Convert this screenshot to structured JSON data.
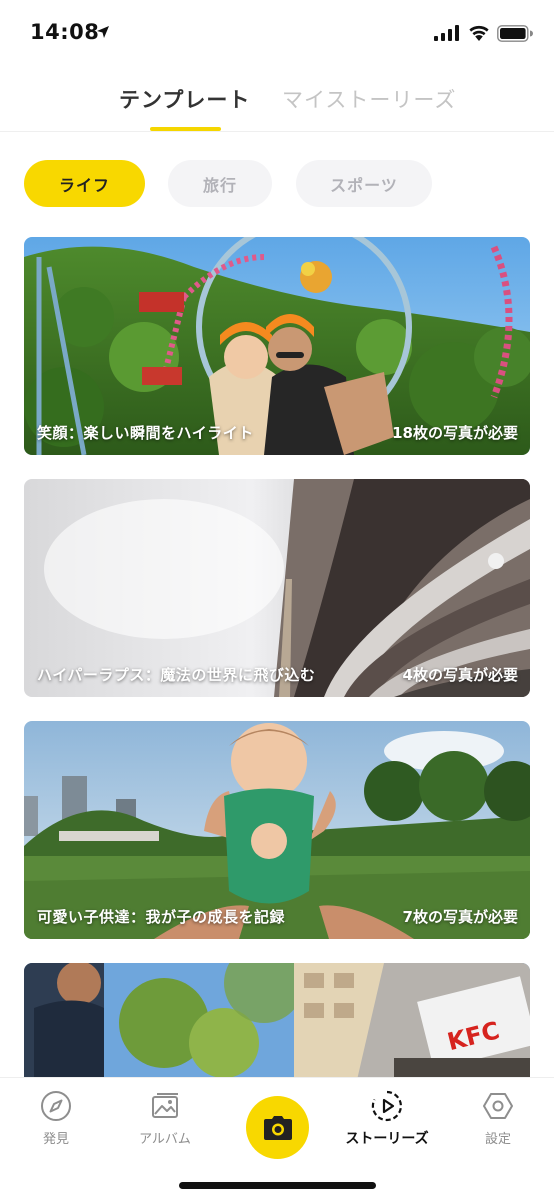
{
  "status_bar": {
    "time": "14:08"
  },
  "top_tabs": [
    {
      "label": "テンプレート",
      "active": true
    },
    {
      "label": "マイストーリーズ",
      "active": false
    }
  ],
  "filter_chips": [
    {
      "label": "ライフ",
      "selected": true
    },
    {
      "label": "旅行",
      "selected": false
    },
    {
      "label": "スポーツ",
      "selected": false
    }
  ],
  "templates": [
    {
      "title": "笑顔：楽しい瞬間をハイライト",
      "count": "18枚の写真が必要"
    },
    {
      "title": "ハイパーラプス：魔法の世界に飛び込む",
      "count": "4枚の写真が必要"
    },
    {
      "title": "可愛い子供達：我が子の成長を記録",
      "count": "7枚の写真が必要"
    },
    {
      "title": "",
      "count": ""
    }
  ],
  "bottom_nav": [
    {
      "label": "発見",
      "icon": "compass-icon",
      "active": false
    },
    {
      "label": "アルバム",
      "icon": "album-icon",
      "active": false
    },
    {
      "label": "",
      "icon": "camera-icon",
      "active": false
    },
    {
      "label": "ストーリーズ",
      "icon": "stories-play-icon",
      "active": true
    },
    {
      "label": "設定",
      "icon": "hexagon-settings-icon",
      "active": false
    }
  ],
  "colors": {
    "accent": "#f8d800",
    "inactive_text": "#b2b2b8",
    "active_text": "#222222"
  }
}
